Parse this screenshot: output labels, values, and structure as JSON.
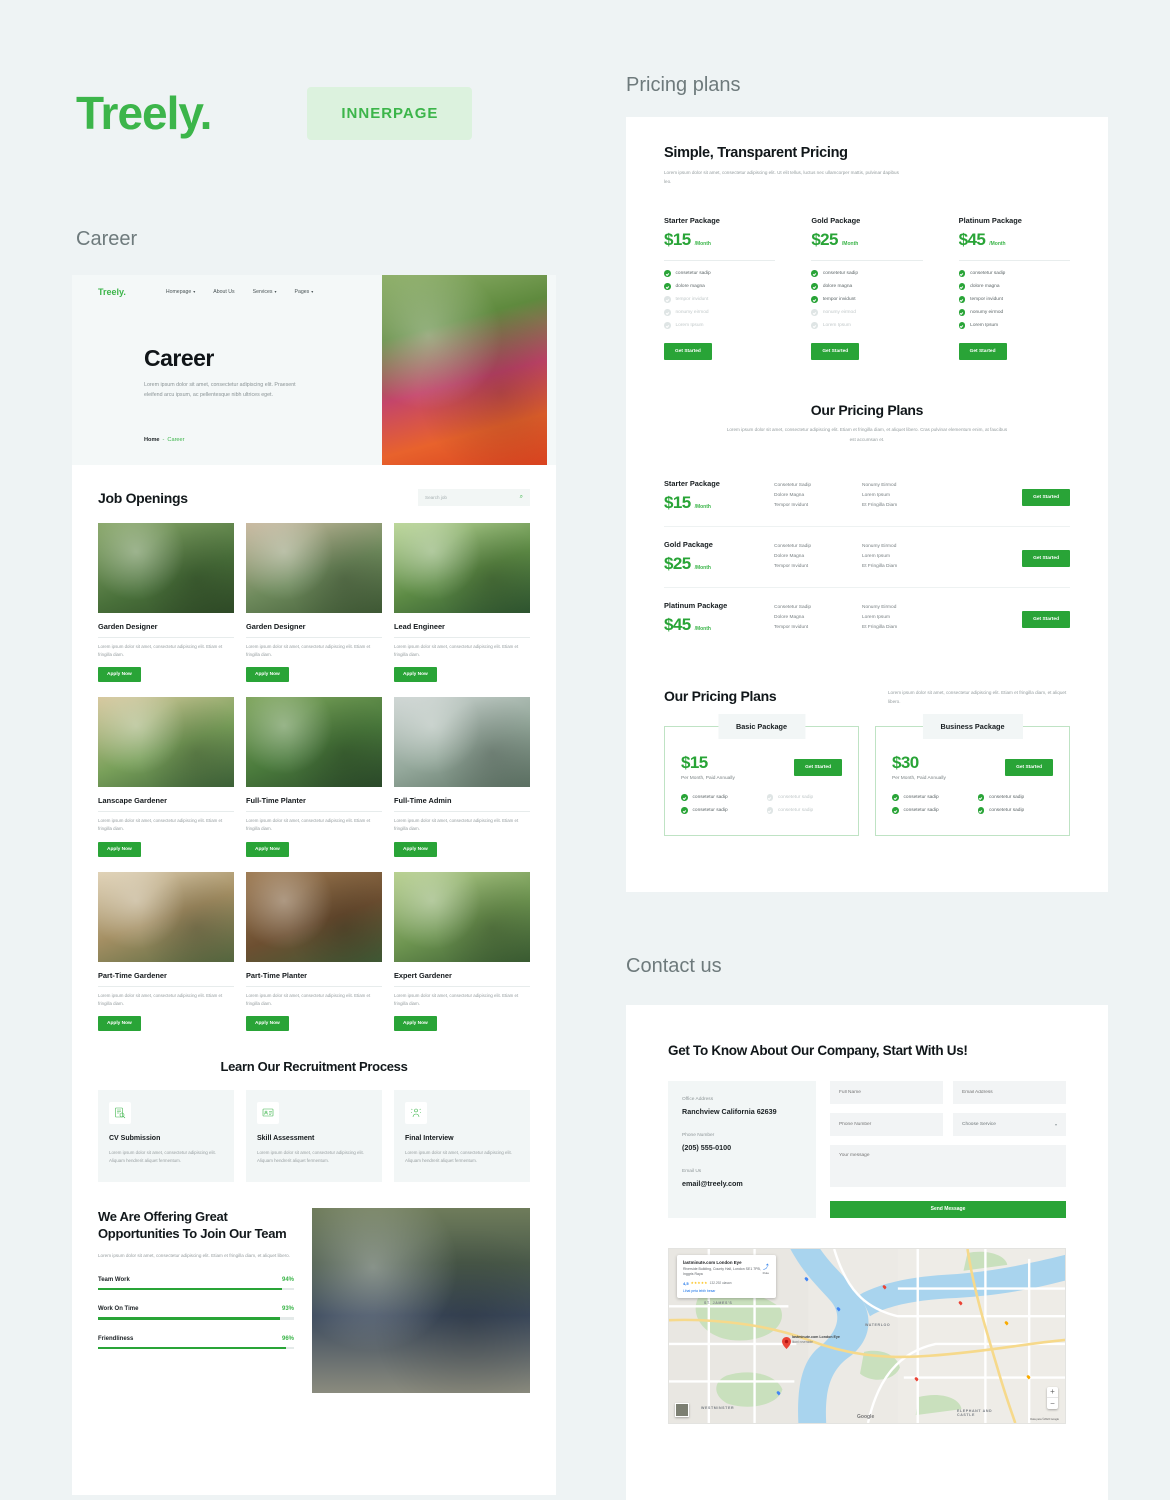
{
  "brand": {
    "name": "Treely",
    "dot": ".",
    "badge": "INNERPAGE"
  },
  "sections": {
    "career_label": "Career",
    "pricing_label": "Pricing plans",
    "contact_label": "Contact us"
  },
  "career": {
    "nav": {
      "logo": "Treely.",
      "items": [
        "Homepage",
        "About Us",
        "Services",
        "Pages"
      ]
    },
    "hero": {
      "title": "Career",
      "subtitle": "Lorem ipsum dolor sit amet, consectetur adipiscing elit. Praesent eleifend arcu ipsum, ac pellentesque nibh ultrices eget.",
      "breadcrumb_home": "Home",
      "breadcrumb_sep": "-",
      "breadcrumb_current": "Career"
    },
    "jobs": {
      "heading": "Job Openings",
      "search_placeholder": "Search job",
      "desc": "Lorem ipsum dolor sit amet, consectetur adipiscing elit. Etiam et fringilla diam.",
      "apply_label": "Apply Now",
      "items": [
        "Garden Designer",
        "Garden Designer",
        "Lead Engineer",
        "Lanscape Gardener",
        "Full-Time Planter",
        "Full-Time Admin",
        "Part-Time Gardener",
        "Part-Time Planter",
        "Expert Gardener"
      ]
    },
    "process": {
      "heading": "Learn Our Recruitment Process",
      "desc": "Lorem ipsum dolor sit amet, consectetur adipiscing elit. Aliquam hendrerit aliquet fermentum.",
      "steps": [
        {
          "name": "CV Submission",
          "icon": "cv-document-icon"
        },
        {
          "name": "Skill Assessment",
          "icon": "assessment-icon"
        },
        {
          "name": "Final Interview",
          "icon": "interview-icon"
        }
      ]
    },
    "offering": {
      "title": "We Are Offering Great Opportunities To Join Our Team",
      "subtitle": "Lorem ipsum dolor sit amet, consectetur adipiscing elit. Etiam et fringilla diam, et aliquet libero.",
      "skills": [
        {
          "name": "Team Work",
          "pct": "94%",
          "value": 94
        },
        {
          "name": "Work On Time",
          "pct": "93%",
          "value": 93
        },
        {
          "name": "Friendliness",
          "pct": "96%",
          "value": 96
        }
      ]
    }
  },
  "pricing": {
    "block1": {
      "title": "Simple, Transparent Pricing",
      "desc": "Lorem ipsum dolor sit amet, consectetur adipiscing elit. Ut elit tellus, luctus nec ullamcorper mattis, pulvinar dapibus leo.",
      "cta": "Get Started",
      "packages": [
        {
          "name": "Starter Package",
          "price": "$15",
          "per": "/Month",
          "features": [
            {
              "text": "consetetur sadip",
              "on": true
            },
            {
              "text": "dolore magna",
              "on": true
            },
            {
              "text": "tempor invidunt",
              "on": false
            },
            {
              "text": "nonumy eirmod",
              "on": false
            },
            {
              "text": "Lorem Ipsum",
              "on": false
            }
          ]
        },
        {
          "name": "Gold Package",
          "price": "$25",
          "per": "/Month",
          "features": [
            {
              "text": "consetetur sadip",
              "on": true
            },
            {
              "text": "dolore magna",
              "on": true
            },
            {
              "text": "tempor invidunt",
              "on": true
            },
            {
              "text": "nonumy eirmod",
              "on": false
            },
            {
              "text": "Lorem Ipsum",
              "on": false
            }
          ]
        },
        {
          "name": "Platinum Package",
          "price": "$45",
          "per": "/Month",
          "features": [
            {
              "text": "consetetur sadip",
              "on": true
            },
            {
              "text": "dolore magna",
              "on": true
            },
            {
              "text": "tempor invidunt",
              "on": true
            },
            {
              "text": "nonumy eirmod",
              "on": true
            },
            {
              "text": "Lorem Ipsum",
              "on": true
            }
          ]
        }
      ]
    },
    "block2": {
      "title": "Our Pricing Plans",
      "desc": "Lorem ipsum dolor sit amet, consectetur adipiscing elit. Etiam et fringilla diam, et aliquet libero. Cras pulvinar elementum enim, at faucibus est accumsan et.",
      "cta": "Get Started",
      "col_a": [
        "Consetetur Sadip",
        "Dolore Magna",
        "Tempor Invidunt"
      ],
      "col_b": [
        "Nonumy Eirmod",
        "Lorem Ipsum",
        "Et Fringilla Diam"
      ],
      "rows": [
        {
          "name": "Starter Package",
          "price": "$15",
          "per": "/Month"
        },
        {
          "name": "Gold Package",
          "price": "$25",
          "per": "/Month"
        },
        {
          "name": "Platinum Package",
          "price": "$45",
          "per": "/Month"
        }
      ]
    },
    "block3": {
      "title": "Our Pricing Plans",
      "desc": "Lorem ipsum dolor sit amet, consectetur adipiscing elit. Etiam et fringilla diam, et aliquet libero.",
      "cta": "Get Started",
      "tiers": [
        {
          "badge": "Basic Package",
          "price": "$15",
          "per": "Per Month, Paid Annually",
          "features": [
            {
              "text": "consetetur sadip",
              "on": true
            },
            {
              "text": "consetetur sadip",
              "on": false
            },
            {
              "text": "consetetur sadip",
              "on": true
            },
            {
              "text": "consetetur sadip",
              "on": false
            }
          ]
        },
        {
          "badge": "Business Package",
          "price": "$30",
          "per": "Per Month, Paid Annually",
          "features": [
            {
              "text": "consetetur sadip",
              "on": true
            },
            {
              "text": "consetetur sadip",
              "on": true
            },
            {
              "text": "consetetur sadip",
              "on": true
            },
            {
              "text": "consetetur sadip",
              "on": true
            }
          ]
        }
      ]
    }
  },
  "contact": {
    "title": "Get To Know About Our Company, Start With Us!",
    "info": [
      {
        "label": "Office Address",
        "value": "Ranchview California 62639"
      },
      {
        "label": "Phone Number",
        "value": "(205) 555-0100"
      },
      {
        "label": "Email Us",
        "value": "email@treely.com"
      }
    ],
    "form": {
      "full_name": "Full Name",
      "email": "Email Address",
      "phone": "Phone Number",
      "service": "Choose Service",
      "message": "Your message",
      "submit": "Send Message"
    },
    "map": {
      "card_title": "lastminute.com London Eye",
      "card_address": "Riverside Building, County Hall, London SE1 7PB, Inggris Raya",
      "rating": "4,5",
      "stars": "★★★★★",
      "review_count": "132.292 ulasan",
      "more_link": "Lihat peta lebih besar",
      "directions": "Rute",
      "pin_title": "lastminute.com London Eye",
      "pin_sub": "Ikoni roveraide",
      "districts": [
        "ST. JAMES'S",
        "WATERLOO",
        "WESTMINSTER",
        "ELEPHANT AND CASTLE"
      ],
      "google": "Google",
      "attribution": "Data peta ©2022 Google",
      "zoom_in": "+",
      "zoom_out": "−"
    }
  },
  "colors": {
    "green": "#29a437",
    "green_light": "#3cb54a",
    "bg": "#eef3f4"
  }
}
